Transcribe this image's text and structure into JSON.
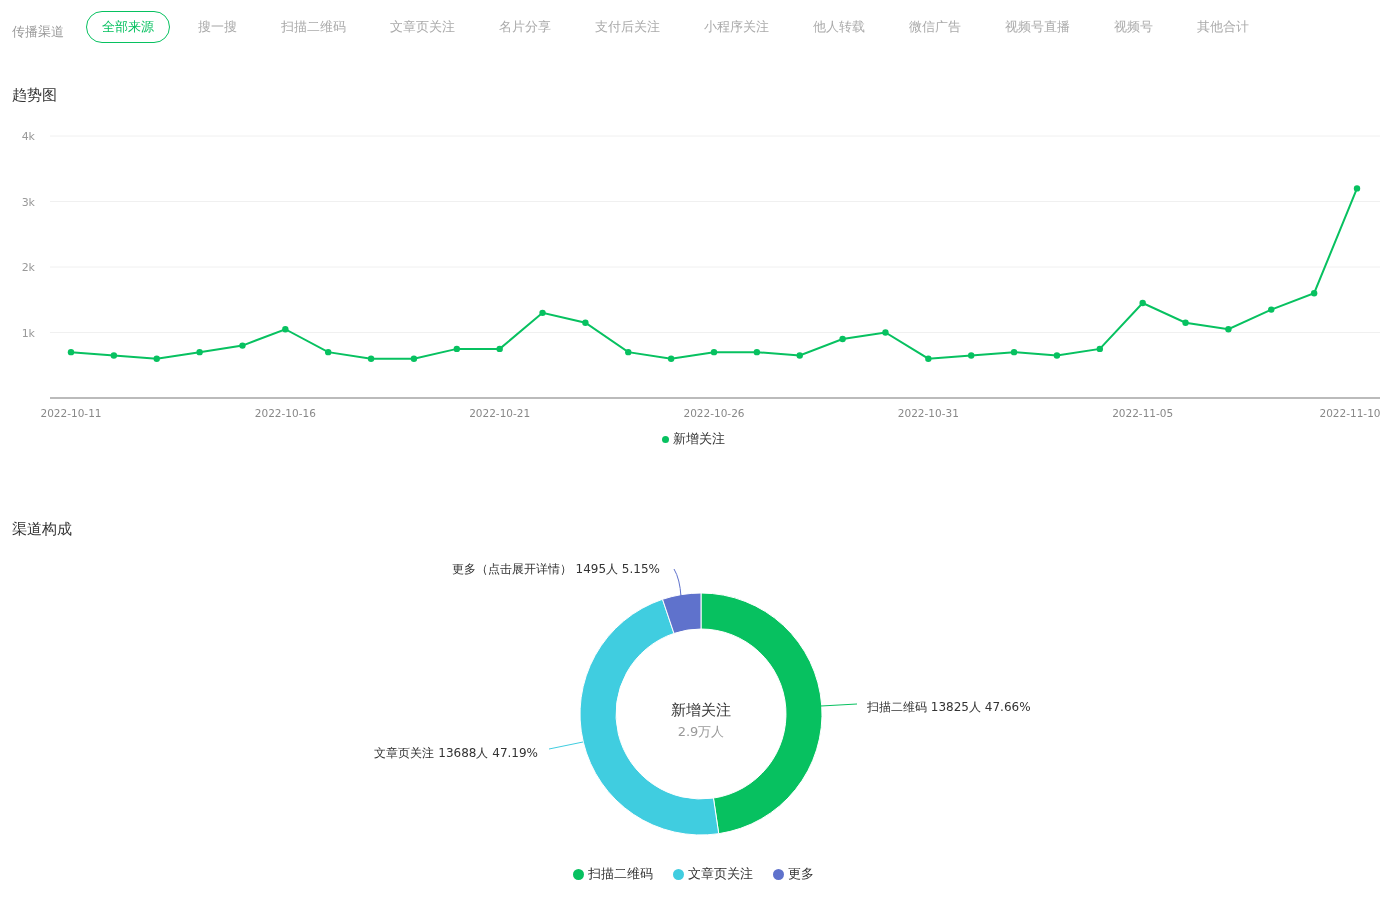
{
  "channel_filter": {
    "label": "传播渠道",
    "tabs": [
      {
        "label": "全部来源",
        "selected": true
      },
      {
        "label": "搜一搜",
        "selected": false
      },
      {
        "label": "扫描二维码",
        "selected": false
      },
      {
        "label": "文章页关注",
        "selected": false
      },
      {
        "label": "名片分享",
        "selected": false
      },
      {
        "label": "支付后关注",
        "selected": false
      },
      {
        "label": "小程序关注",
        "selected": false
      },
      {
        "label": "他人转载",
        "selected": false
      },
      {
        "label": "微信广告",
        "selected": false
      },
      {
        "label": "视频号直播",
        "selected": false
      },
      {
        "label": "视频号",
        "selected": false
      },
      {
        "label": "其他合计",
        "selected": false
      }
    ]
  },
  "trend": {
    "title": "趋势图",
    "chart_data": {
      "type": "line",
      "grid": true,
      "categories": [
        "2022-10-11",
        null,
        null,
        null,
        null,
        "2022-10-16",
        null,
        null,
        null,
        null,
        "2022-10-21",
        null,
        null,
        null,
        null,
        "2022-10-26",
        null,
        null,
        null,
        null,
        "2022-10-31",
        null,
        null,
        null,
        null,
        "2022-11-05",
        null,
        null,
        null,
        null,
        "2022-11-10"
      ],
      "series": [
        {
          "name": "新增关注",
          "color": "#07c160",
          "marker": "circle",
          "values": [
            700,
            650,
            600,
            700,
            800,
            1050,
            700,
            600,
            600,
            750,
            750,
            1300,
            1150,
            700,
            600,
            700,
            700,
            650,
            900,
            1000,
            600,
            650,
            700,
            650,
            750,
            1450,
            1150,
            1050,
            1350,
            1600,
            3200
          ]
        }
      ],
      "ylim": [
        0,
        4000
      ],
      "yticks": [
        {
          "value": 1000,
          "label": "1k"
        },
        {
          "value": 2000,
          "label": "2k"
        },
        {
          "value": 3000,
          "label": "3k"
        },
        {
          "value": 4000,
          "label": "4k"
        }
      ]
    }
  },
  "composition": {
    "title": "渠道构成",
    "center_value": "2.9万人",
    "chart_data": {
      "type": "donut",
      "categories": [
        "扫描二维码",
        "文章页关注",
        "更多"
      ],
      "series": [
        {
          "name": "新增关注",
          "values": [
            47.66,
            47.19,
            5.15
          ]
        }
      ],
      "colors": [
        "#07c160",
        "#40cde0",
        "#5f72cc"
      ]
    },
    "slice_labels": [
      "扫描二维码 13825人 47.66%",
      "文章页关注 13688人 47.19%",
      "更多（点击展开详情） 1495人 5.15%"
    ]
  }
}
